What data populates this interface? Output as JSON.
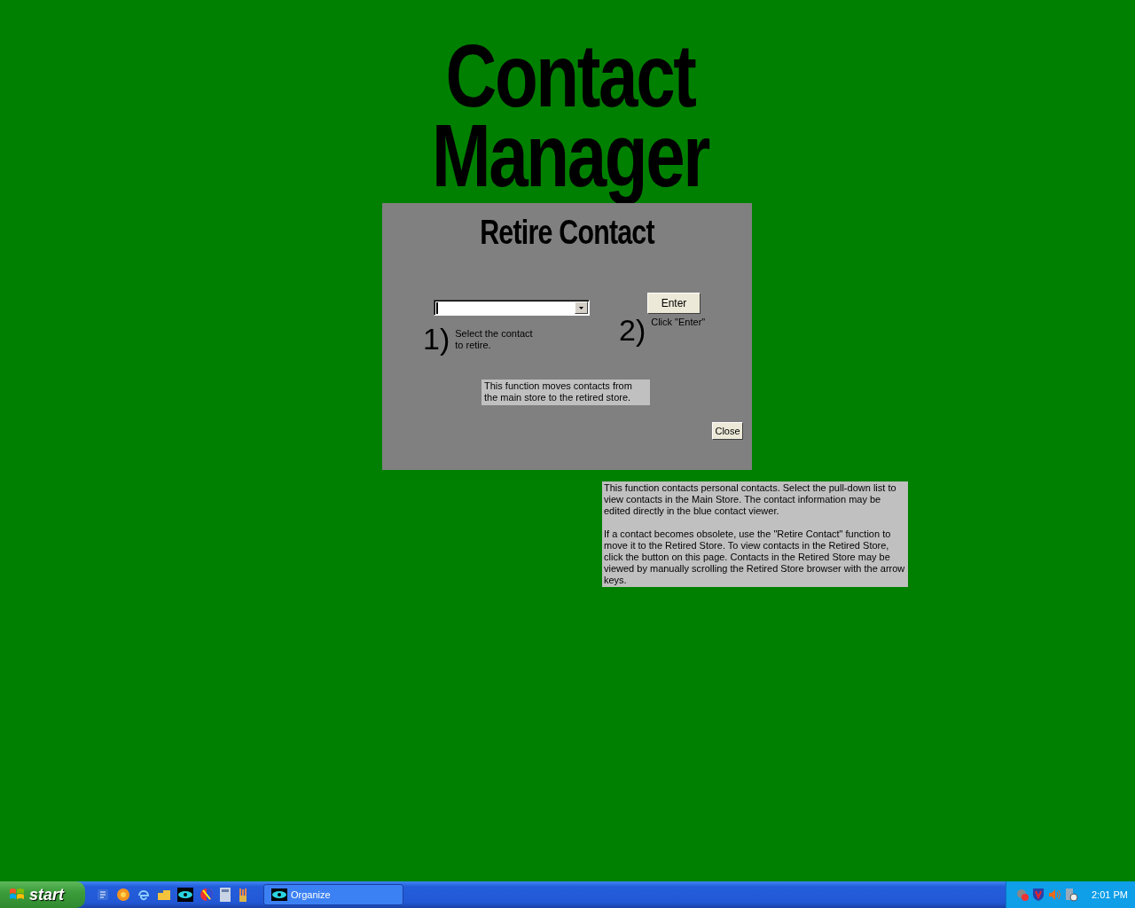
{
  "app_title": "Contact Manager",
  "dialog": {
    "title": "Retire Contact",
    "steps": [
      {
        "number": "1)",
        "text": "Select the contact to retire."
      },
      {
        "number": "2)",
        "text": "Click \"Enter\""
      }
    ],
    "enter_button": "Enter",
    "note": "This function moves contacts from the main store to the retired store.",
    "close_button": "Close"
  },
  "help": [
    "This function contacts personal contacts.  Select the pull-down list to view contacts in the Main Store.  The contact information may be edited directly in the blue contact viewer.",
    "If a contact becomes obsolete, use the \"Retire Contact\" function to move it to the Retired Store.  To view contacts in the Retired Store, click the button on this page.  Contacts in the Retired Store may be viewed by manually scrolling the Retired Store browser with the arrow keys."
  ],
  "taskbar": {
    "start": "start",
    "tasks": [
      {
        "label": "Organize"
      }
    ],
    "clock": "2:01 PM"
  }
}
